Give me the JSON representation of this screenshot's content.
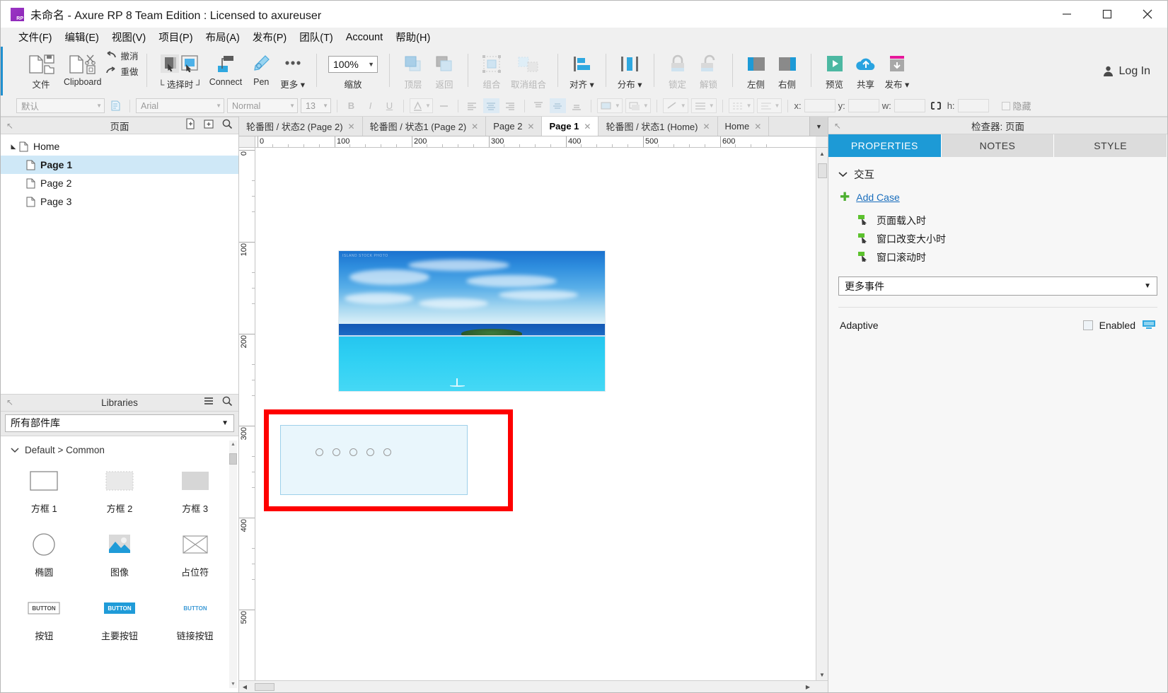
{
  "window": {
    "title": "未命名 - Axure RP 8 Team Edition : Licensed to axureuser",
    "app_icon": "axure-rp-logo-icon",
    "minimize": "—",
    "maximize": "☐",
    "close": "✕"
  },
  "menubar": [
    {
      "label": "文件(F)",
      "accel": "F"
    },
    {
      "label": "编辑(E)",
      "accel": "E"
    },
    {
      "label": "视图(V)",
      "accel": "V"
    },
    {
      "label": "项目(P)",
      "accel": "P"
    },
    {
      "label": "布局(A)",
      "accel": "A"
    },
    {
      "label": "发布(P)",
      "accel": "P"
    },
    {
      "label": "团队(T)",
      "accel": "T"
    },
    {
      "label": "Account",
      "accel": "A"
    },
    {
      "label": "帮助(H)",
      "accel": "H"
    }
  ],
  "toolbar": {
    "file_label": "文件",
    "clipboard_label": "Clipboard",
    "undo_label": "撤消",
    "redo_label": "重做",
    "select_label": "└ 选择时 ┘",
    "connect_label": "Connect",
    "pen_label": "Pen",
    "more_label": "更多 ▾",
    "zoom_value": "100%",
    "zoom_label": "缩放",
    "front_label": "顶层",
    "back_label": "返回",
    "group_label": "组合",
    "ungroup_label": "取消组合",
    "align_label": "对齐 ▾",
    "distribute_label": "分布 ▾",
    "lock_label": "锁定",
    "unlock_label": "解锁",
    "left_pane_label": "左侧",
    "right_pane_label": "右侧",
    "preview_label": "预览",
    "share_label": "共享",
    "publish_label": "发布 ▾",
    "login_label": "Log In"
  },
  "stylebar": {
    "style_value": "默认",
    "font_value": "Arial",
    "weight_value": "Normal",
    "size_value": "13",
    "bold": "B",
    "italic": "I",
    "underline": "U",
    "x_label": "x:",
    "y_label": "y:",
    "w_label": "w:",
    "h_label": "h:",
    "x_value": "",
    "y_value": "",
    "w_value": "",
    "h_value": "",
    "hidden_label": "隐藏"
  },
  "pages_panel": {
    "title": "页面",
    "icons": [
      "add-page-icon",
      "add-folder-icon",
      "search-icon"
    ],
    "tree": [
      {
        "label": "Home",
        "depth": 0,
        "expanded": true,
        "selected": false
      },
      {
        "label": "Page 1",
        "depth": 1,
        "expanded": false,
        "selected": true
      },
      {
        "label": "Page 2",
        "depth": 1,
        "expanded": false,
        "selected": false
      },
      {
        "label": "Page 3",
        "depth": 1,
        "expanded": false,
        "selected": false
      }
    ]
  },
  "libraries_panel": {
    "title": "Libraries",
    "icons": [
      "menu-icon",
      "search-icon"
    ],
    "selected_library": "所有部件库",
    "group_label": "Default > Common",
    "widgets": [
      {
        "label": "方框 1",
        "kind": "box-outline"
      },
      {
        "label": "方框 2",
        "kind": "box-dotted"
      },
      {
        "label": "方框 3",
        "kind": "box-filled"
      },
      {
        "label": "椭圆",
        "kind": "ellipse"
      },
      {
        "label": "图像",
        "kind": "image"
      },
      {
        "label": "占位符",
        "kind": "placeholder"
      },
      {
        "label": "按钮",
        "kind": "button-plain"
      },
      {
        "label": "主要按钮",
        "kind": "button-primary"
      },
      {
        "label": "链接按钮",
        "kind": "button-link"
      }
    ]
  },
  "tabs": [
    {
      "label": "轮番图 / 状态2 (Page 2)",
      "active": false,
      "closable": true
    },
    {
      "label": "轮番图 / 状态1 (Page 2)",
      "active": false,
      "closable": true
    },
    {
      "label": "Page 2",
      "active": false,
      "closable": true
    },
    {
      "label": "Page 1",
      "active": true,
      "closable": true
    },
    {
      "label": "轮番图 / 状态1 (Home)",
      "active": false,
      "closable": true
    },
    {
      "label": "Home",
      "active": false,
      "closable": true
    }
  ],
  "canvas": {
    "ruler_h_labels": [
      "0",
      "100",
      "200",
      "300",
      "400",
      "500",
      "600"
    ],
    "ruler_v_labels": [
      "0",
      "100",
      "200",
      "300",
      "400",
      "500"
    ],
    "image_watermark": "ISLAND STOCK PHOTO",
    "dot_count": 5,
    "annotation_color": "#fe0000",
    "panel_fill": "#e9f6fc",
    "panel_border": "#9ed0ea"
  },
  "inspector": {
    "title": "检查器: 页面",
    "tabs": [
      {
        "label": "PROPERTIES",
        "active": true
      },
      {
        "label": "NOTES",
        "active": false
      },
      {
        "label": "STYLE",
        "active": false
      }
    ],
    "section_label": "交互",
    "add_case_label": "Add Case",
    "events": [
      "页面载入时",
      "窗口改变大小时",
      "窗口滚动时"
    ],
    "more_events_label": "更多事件",
    "adaptive_label": "Adaptive",
    "enabled_label": "Enabled",
    "adaptive_icon": "monitor-icon"
  }
}
